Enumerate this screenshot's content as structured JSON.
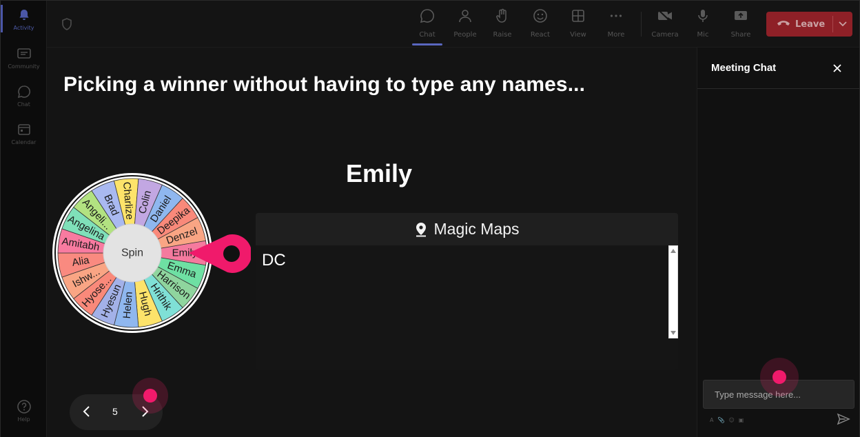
{
  "rail": {
    "items": [
      {
        "label": "Activity",
        "icon": "bell-icon"
      },
      {
        "label": "Community",
        "icon": "community-icon"
      },
      {
        "label": "Chat",
        "icon": "chat-icon"
      },
      {
        "label": "Calendar",
        "icon": "calendar-icon"
      },
      {
        "label": "Help",
        "icon": "help-icon"
      }
    ]
  },
  "toolbar": {
    "chat": "Chat",
    "people": "People",
    "raise": "Raise",
    "react": "React",
    "view": "View",
    "more": "More",
    "camera": "Camera",
    "mic": "Mic",
    "share": "Share",
    "leave": "Leave"
  },
  "stage": {
    "headline": "Picking a winner without having to type any names...",
    "winner": "Emily",
    "spin_label": "Spin",
    "wheel_names": [
      "Emily",
      "Emma",
      "Harrison",
      "Hrithik",
      "Hugh",
      "Helen",
      "Hyesun",
      "Hyose...",
      "Ishw...",
      "Alia",
      "Amitabh",
      "Angelina",
      "Angeli...",
      "Brad",
      "Charlize",
      "Colin",
      "Daniel",
      "Deepika",
      "Denzel"
    ],
    "wheel_colors": [
      "#f57a9e",
      "#6ee0a3",
      "#8fd59e",
      "#7fe0d6",
      "#fde36a",
      "#8fb7ef",
      "#a3b1e8",
      "#f9897a",
      "#f9a584",
      "#f98a80",
      "#f87ba0",
      "#7fe0b9",
      "#b2e281",
      "#a9b9f0",
      "#fde36a",
      "#c2a7e2",
      "#8fb7ef",
      "#f9897a",
      "#f9a584"
    ]
  },
  "panel": {
    "title": "Magic Maps",
    "body_text": "DC"
  },
  "pager": {
    "page": "5"
  },
  "chat": {
    "title": "Meeting Chat",
    "placeholder": "Type message here..."
  }
}
